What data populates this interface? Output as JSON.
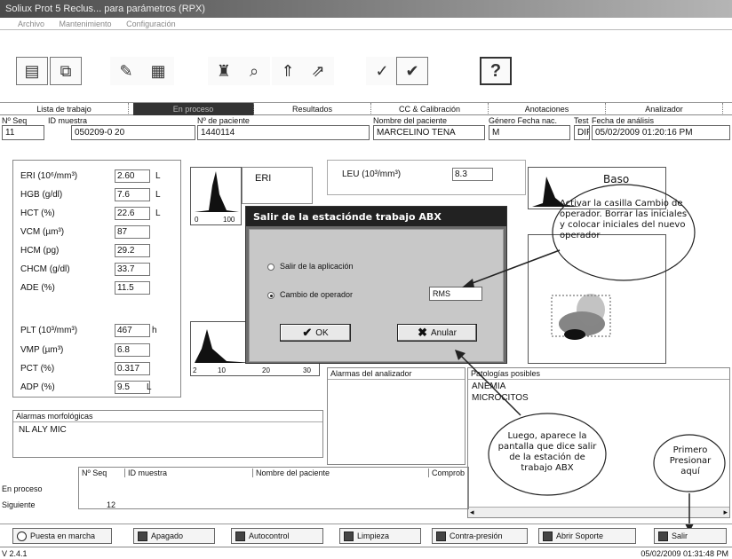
{
  "window": {
    "title": "Soliux Prot 5 Reclus... para parámetros (RPX)"
  },
  "menu": [
    "Archivo",
    "Mantenimiento",
    "Configuración"
  ],
  "toolbar_icons": [
    "printer-icon",
    "chart-icon",
    "sample-icon",
    "archive-icon",
    "patient-search-icon",
    "analyzer-search-icon",
    "arrow-up-icon",
    "transfer-icon",
    "validate-icon",
    "validate-all-icon",
    "help-icon"
  ],
  "help_label": "?",
  "tabs": [
    "Lista de trabajo",
    "En proceso",
    "Resultados",
    "CC & Calibración",
    "Anotaciones",
    "Analizador"
  ],
  "sample_header": {
    "labels": {
      "seq": "Nº Seq",
      "sample_id": "ID muestra",
      "patient_no": "Nº de paciente",
      "patient_name": "Nombre del paciente",
      "gender_dob": "Género Fecha nac.",
      "test": "Test",
      "analysis_date": "Fecha de análisis"
    },
    "values": {
      "seq": "11",
      "sample_id": "050209-0 20",
      "patient_no": "1440114",
      "patient_name": "MARCELINO TENA",
      "gender": "M",
      "test": "DIF",
      "analysis_date": "05/02/2009 01:20:16 PM"
    }
  },
  "results": [
    {
      "label": "ERI (10⁶/mm³)",
      "value": "2.60",
      "flag": "L"
    },
    {
      "label": "HGB (g/dl)",
      "value": "7.6",
      "flag": "L"
    },
    {
      "label": "HCT (%)",
      "value": "22.6",
      "flag": "L"
    },
    {
      "label": "VCM (µm³)",
      "value": "87",
      "flag": ""
    },
    {
      "label": "HCM (pg)",
      "value": "29.2",
      "flag": ""
    },
    {
      "label": "CHCM (g/dl)",
      "value": "33.7",
      "flag": ""
    },
    {
      "label": "ADE (%)",
      "value": "11.5",
      "flag": ""
    }
  ],
  "plt_results": [
    {
      "label": "PLT (10³/mm³)",
      "value": "467",
      "flag": "h"
    },
    {
      "label": "VMP (µm³)",
      "value": "6.8",
      "flag": ""
    },
    {
      "label": "PCT (%)",
      "value": "0.317",
      "flag": ""
    },
    {
      "label": "ADP (%)",
      "value": "9.5",
      "flag": "L"
    }
  ],
  "histograms": {
    "eri_label": "ERI",
    "eri_ticks": [
      "0",
      "100"
    ],
    "plt_ticks": [
      "2",
      "10",
      "20",
      "30"
    ],
    "baso_label": "Baso"
  },
  "leu": {
    "label": "LEU (10³/mm³)",
    "value": "8.3"
  },
  "morph_alarms": {
    "title": "Alarmas morfológicas",
    "text": "NL ALY MIC"
  },
  "analyzer_alarms": {
    "title": "Alarmas del analizador"
  },
  "pathologies": {
    "title": "Patologías posibles",
    "items": [
      "ANEMIA",
      "MICROCITOS"
    ]
  },
  "dialog": {
    "title": "Salir de la estaciónde trabajo ABX",
    "option_exit": "Salir de la aplicación",
    "option_change": "Cambio de operador",
    "operator_value": "RMS",
    "ok_label": "OK",
    "cancel_label": "Anular"
  },
  "callouts": {
    "activate": "Activar la casilla Cambio de operador. Borrar las iniciales y colocar iniciales del nuevo operador",
    "then": "Luego, aparece la pantalla que dice salir de la estación de trabajo ABX",
    "first": "Primero Presionar aquí"
  },
  "queue_table": {
    "headers": [
      "Nº Seq",
      "ID muestra",
      "Nombre del paciente",
      "Comprob"
    ],
    "rows": [
      {
        "label": "En proceso",
        "seq": ""
      },
      {
        "label": "Siguiente",
        "seq": "12"
      }
    ]
  },
  "bottom_buttons": [
    "Puesta en marcha",
    "Apagado",
    "Autocontrol",
    "Limpieza",
    "Contra-presión",
    "Abrir Soporte",
    "Salir"
  ],
  "status": {
    "version": "V 2.4.1",
    "datetime": "05/02/2009 01:31:48 PM"
  }
}
